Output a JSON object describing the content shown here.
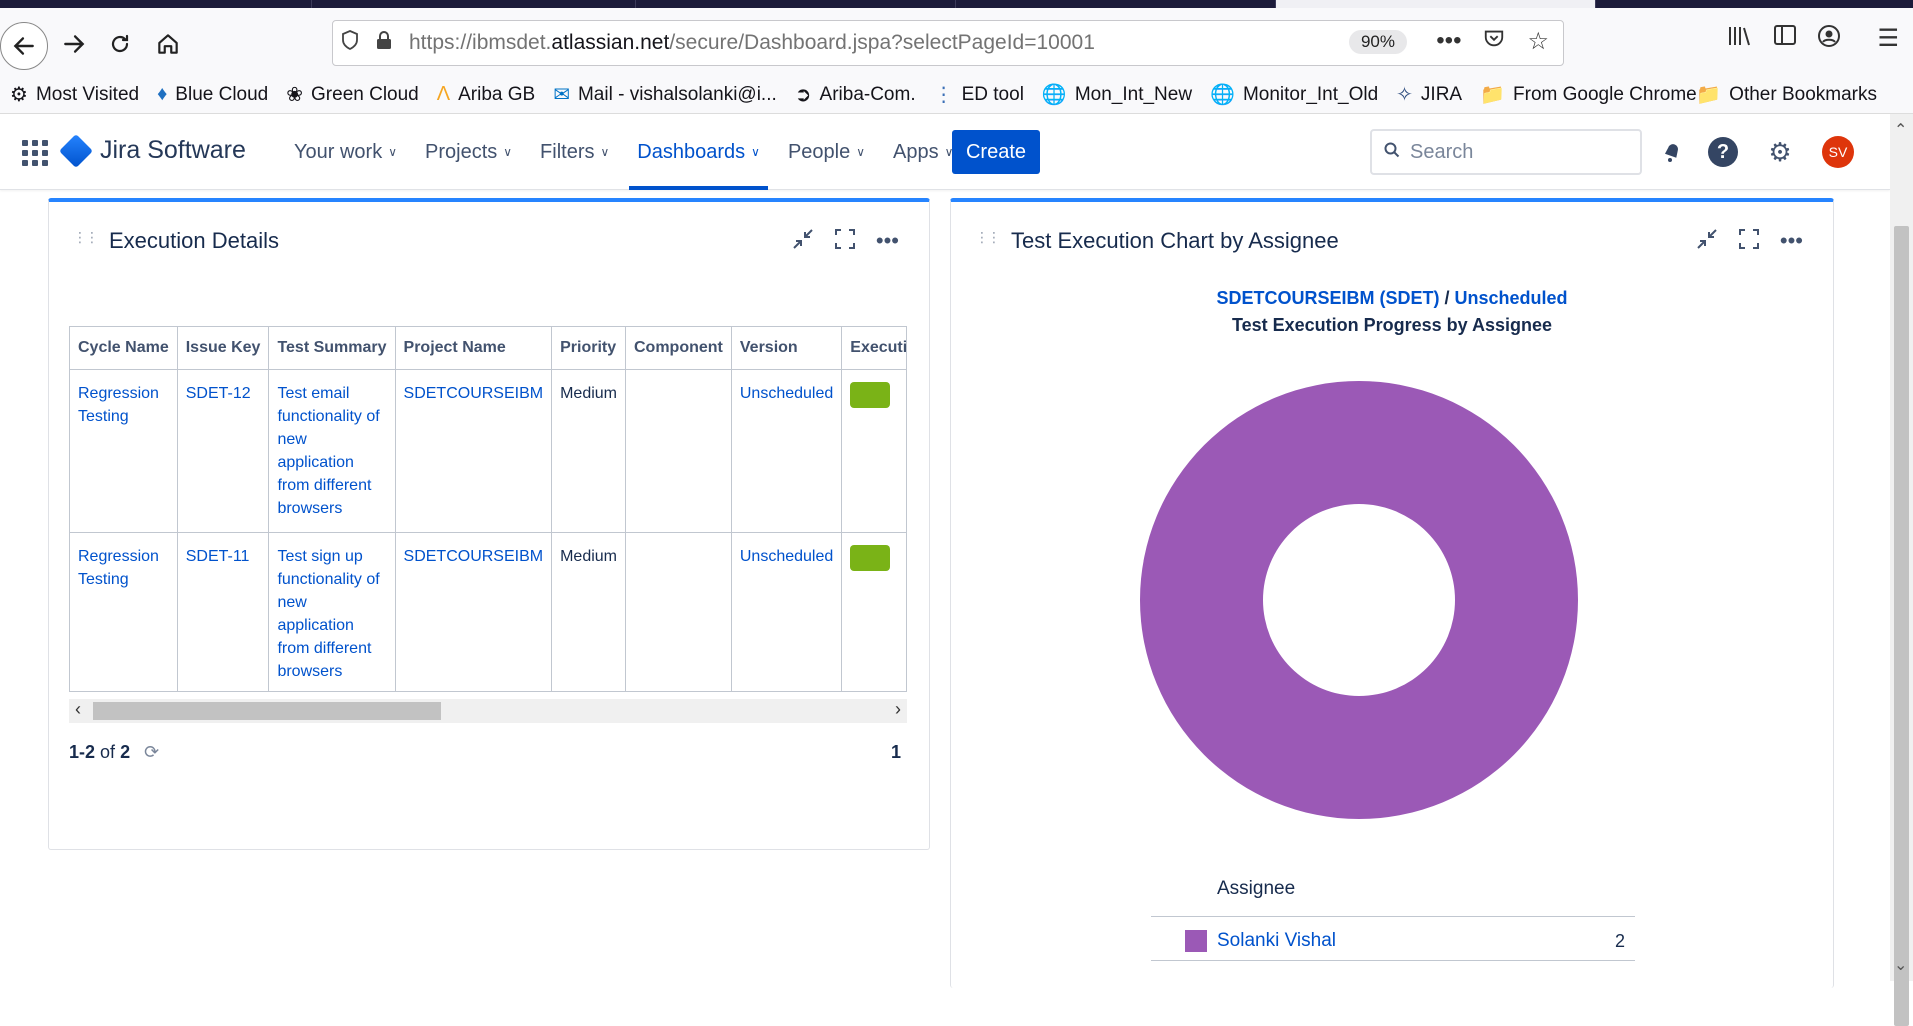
{
  "browser": {
    "url_prefix": "https://ibmsdet.",
    "url_domain": "atlassian.net",
    "url_path": "/secure/Dashboard.jspa?selectPageId=10001",
    "zoom": "90%",
    "bookmarks": [
      {
        "label": "Most Visited",
        "icon": "gear-icon"
      },
      {
        "label": "Blue Cloud",
        "icon": "shield-icon"
      },
      {
        "label": "Green Cloud",
        "icon": "bee-icon"
      },
      {
        "label": "Ariba GB",
        "icon": "ariba-icon"
      },
      {
        "label": "Mail - vishalsolanki@i...",
        "icon": "outlook-icon"
      },
      {
        "label": "Ariba-Com.",
        "icon": "arrow-circle-icon"
      },
      {
        "label": "ED tool",
        "icon": "dots-icon"
      },
      {
        "label": "Mon_Int_New",
        "icon": "globe-icon"
      },
      {
        "label": "Monitor_Int_Old",
        "icon": "globe-icon"
      },
      {
        "label": "JIRA",
        "icon": "jira-icon"
      },
      {
        "label": "From Google Chrome",
        "icon": "folder-icon"
      }
    ],
    "other_bookmarks": "Other Bookmarks"
  },
  "jira": {
    "product": "Jira Software",
    "menu": [
      "Your work",
      "Projects",
      "Filters",
      "Dashboards",
      "People",
      "Apps"
    ],
    "active_menu": "Dashboards",
    "create_label": "Create",
    "search_placeholder": "Search",
    "avatar_initials": "SV"
  },
  "execution_details": {
    "title": "Execution Details",
    "columns": [
      "Cycle Name",
      "Issue Key",
      "Test Summary",
      "Project Name",
      "Priority",
      "Component",
      "Version",
      "Execution"
    ],
    "rows": [
      {
        "cycle": "Regression Testing",
        "key": "SDET-12",
        "summary": "Test email functionality of new application from different browsers",
        "project": "SDETCOURSEIBM",
        "priority": "Medium",
        "component": "",
        "version": "Unscheduled",
        "status_color": "#7ab317"
      },
      {
        "cycle": "Regression Testing",
        "key": "SDET-11",
        "summary": "Test sign up functionality of new application from different browsers",
        "project": "SDETCOURSEIBM",
        "priority": "Medium",
        "component": "",
        "version": "Unscheduled",
        "status_color": "#7ab317"
      }
    ],
    "pager_range_start": "1",
    "pager_range_end": "2",
    "pager_of": "of",
    "pager_total": "2",
    "page_number": "1"
  },
  "assignee_chart": {
    "title": "Test Execution Chart by Assignee",
    "project_link": "SDETCOURSEIBM (SDET)",
    "separator": "/",
    "version_link": "Unscheduled",
    "subtitle": "Test Execution Progress by Assignee",
    "legend_header": "Assignee",
    "chart_data": {
      "type": "pie",
      "categories": [
        "Solanki Vishal"
      ],
      "values": [
        2
      ],
      "colors": [
        "#9b59b6"
      ]
    }
  }
}
